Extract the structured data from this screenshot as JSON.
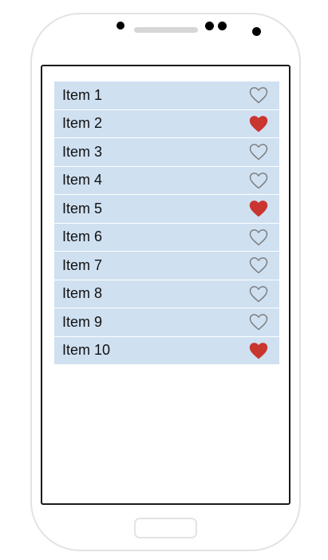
{
  "colors": {
    "row_background": "#cfe0f1",
    "heart_filled": "#c9352f",
    "heart_outline": "#7a7a7a"
  },
  "list": {
    "items": [
      {
        "label": "Item 1",
        "favorite": false
      },
      {
        "label": "Item 2",
        "favorite": true
      },
      {
        "label": "Item 3",
        "favorite": false
      },
      {
        "label": "Item 4",
        "favorite": false
      },
      {
        "label": "Item 5",
        "favorite": true
      },
      {
        "label": "Item 6",
        "favorite": false
      },
      {
        "label": "Item 7",
        "favorite": false
      },
      {
        "label": "Item 8",
        "favorite": false
      },
      {
        "label": "Item 9",
        "favorite": false
      },
      {
        "label": "Item 10",
        "favorite": true
      }
    ]
  }
}
